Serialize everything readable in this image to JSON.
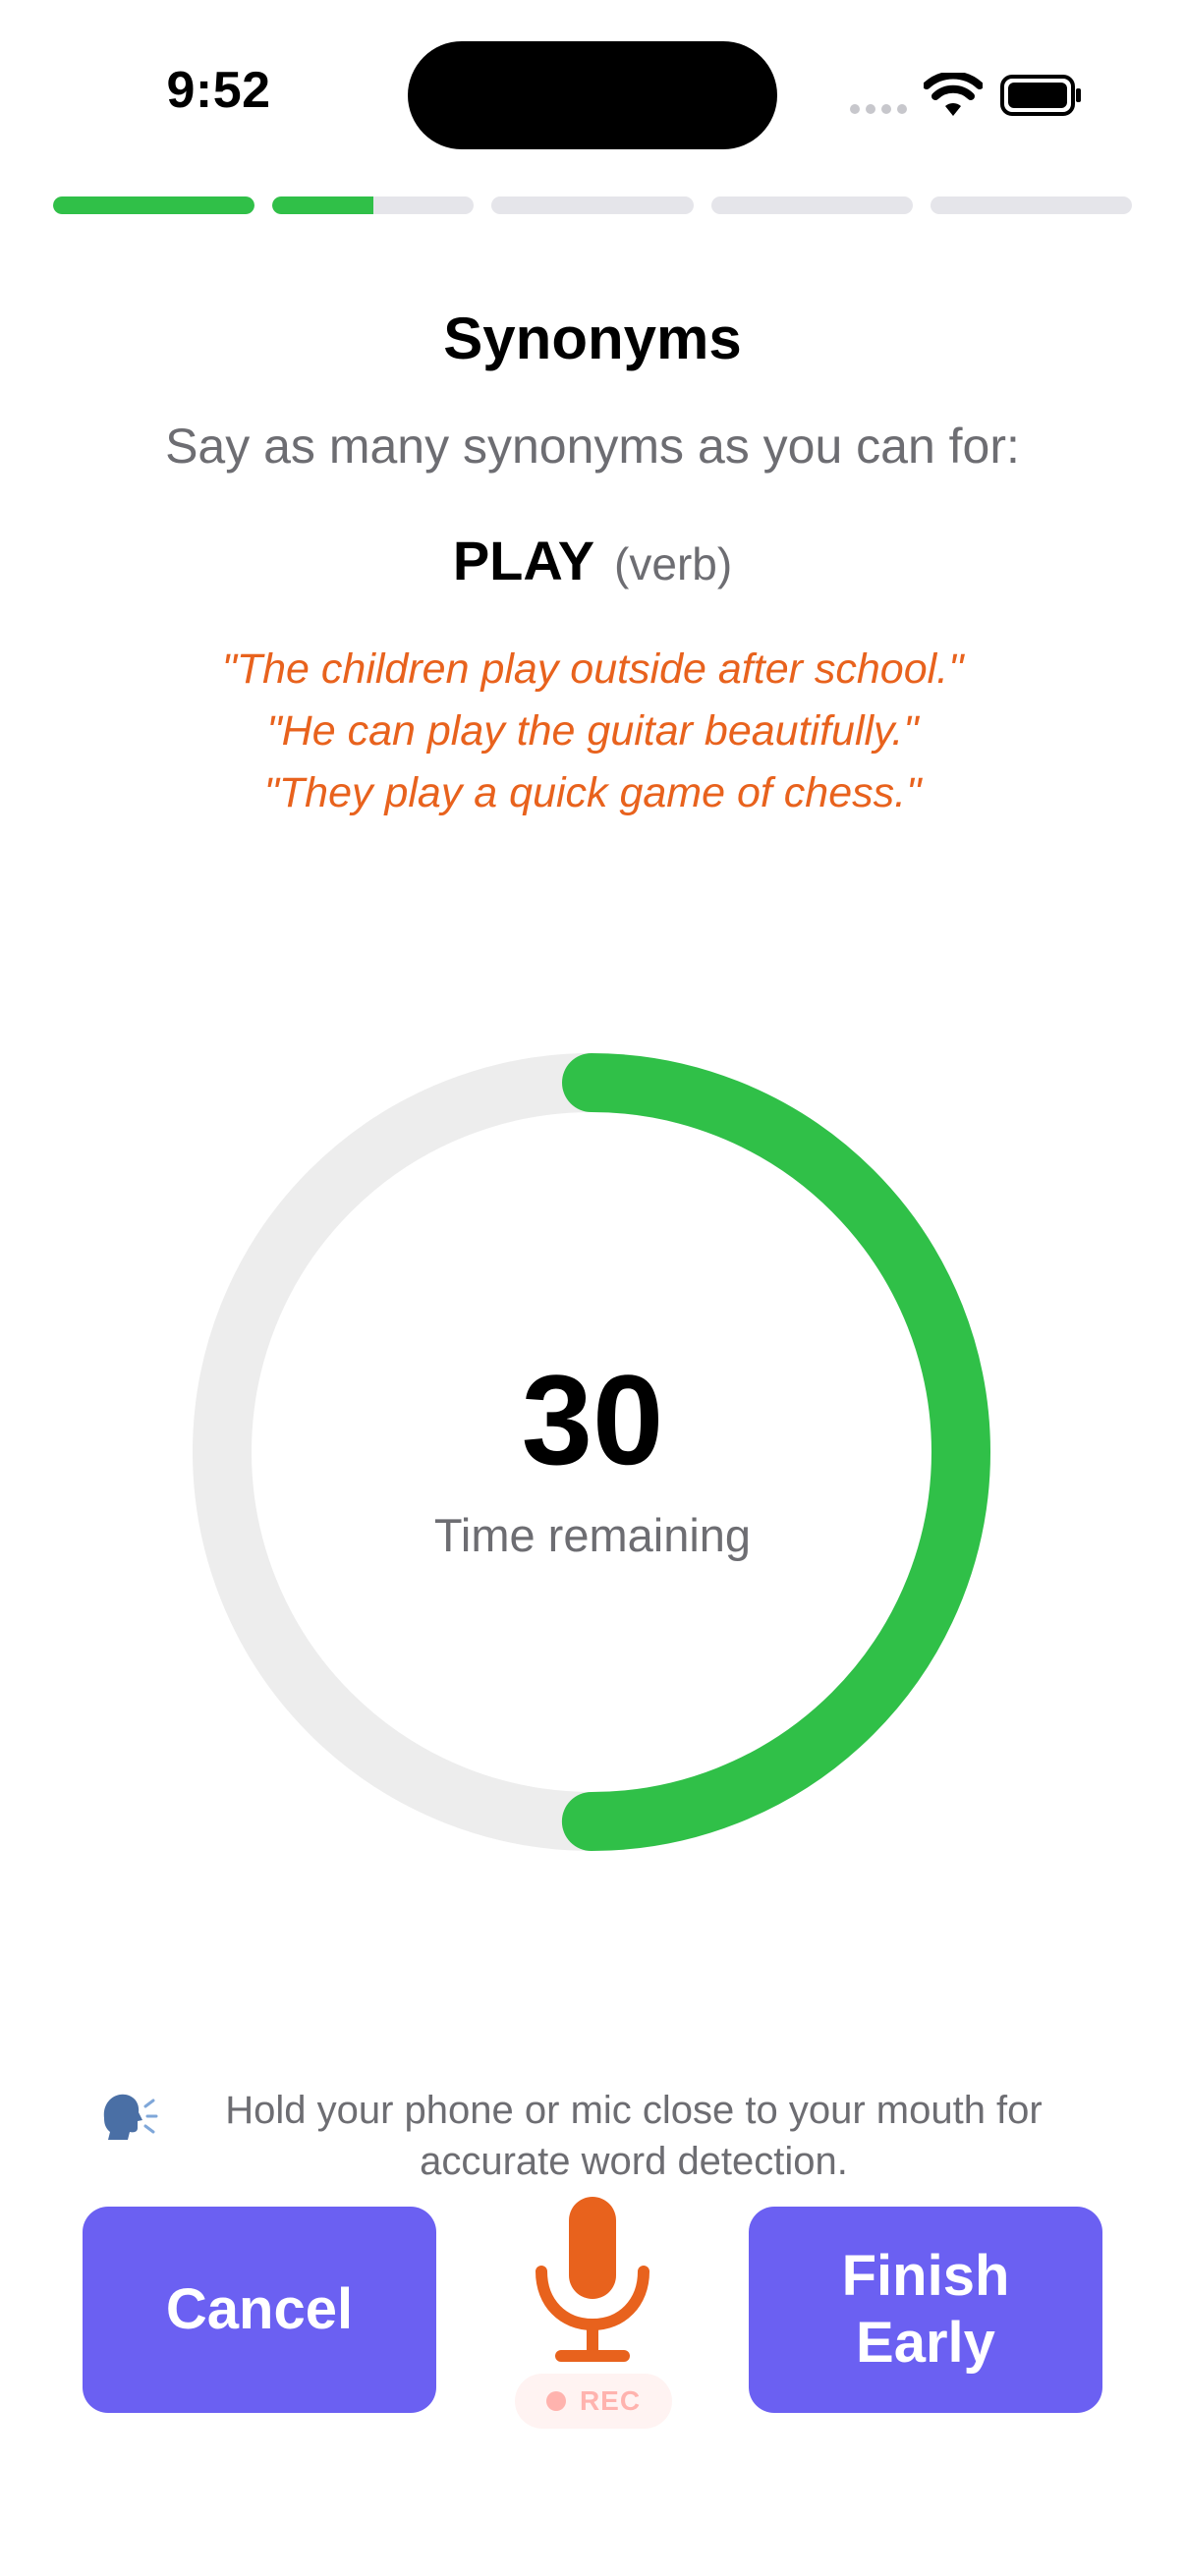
{
  "status_bar": {
    "time": "9:52"
  },
  "progress": {
    "segments": [
      1,
      0.5,
      0,
      0,
      0
    ],
    "fill_color": "#30c048",
    "track_color": "#e5e5ea"
  },
  "exercise": {
    "title": "Synonyms",
    "instruction": "Say as many synonyms as you can for:",
    "word": "PLAY",
    "part_of_speech": "(verb)",
    "examples": [
      "\"The children play outside after school.\"",
      "\"He can play the guitar beautifully.\"",
      "\"They play a quick game of chess.\""
    ]
  },
  "timer": {
    "value": "30",
    "label": "Time remaining",
    "remaining_fraction": 0.5,
    "ring_color": "#30c048",
    "track_color": "#ededed"
  },
  "hint": {
    "icon": "speaking-head-icon",
    "text": "Hold your phone or mic close to your mouth for accurate word detection."
  },
  "controls": {
    "cancel_label": "Cancel",
    "finish_label": "Finish Early",
    "mic_icon": "microphone-icon",
    "rec_label": "REC",
    "button_color": "#6b60f2",
    "mic_color": "#e8621d"
  }
}
